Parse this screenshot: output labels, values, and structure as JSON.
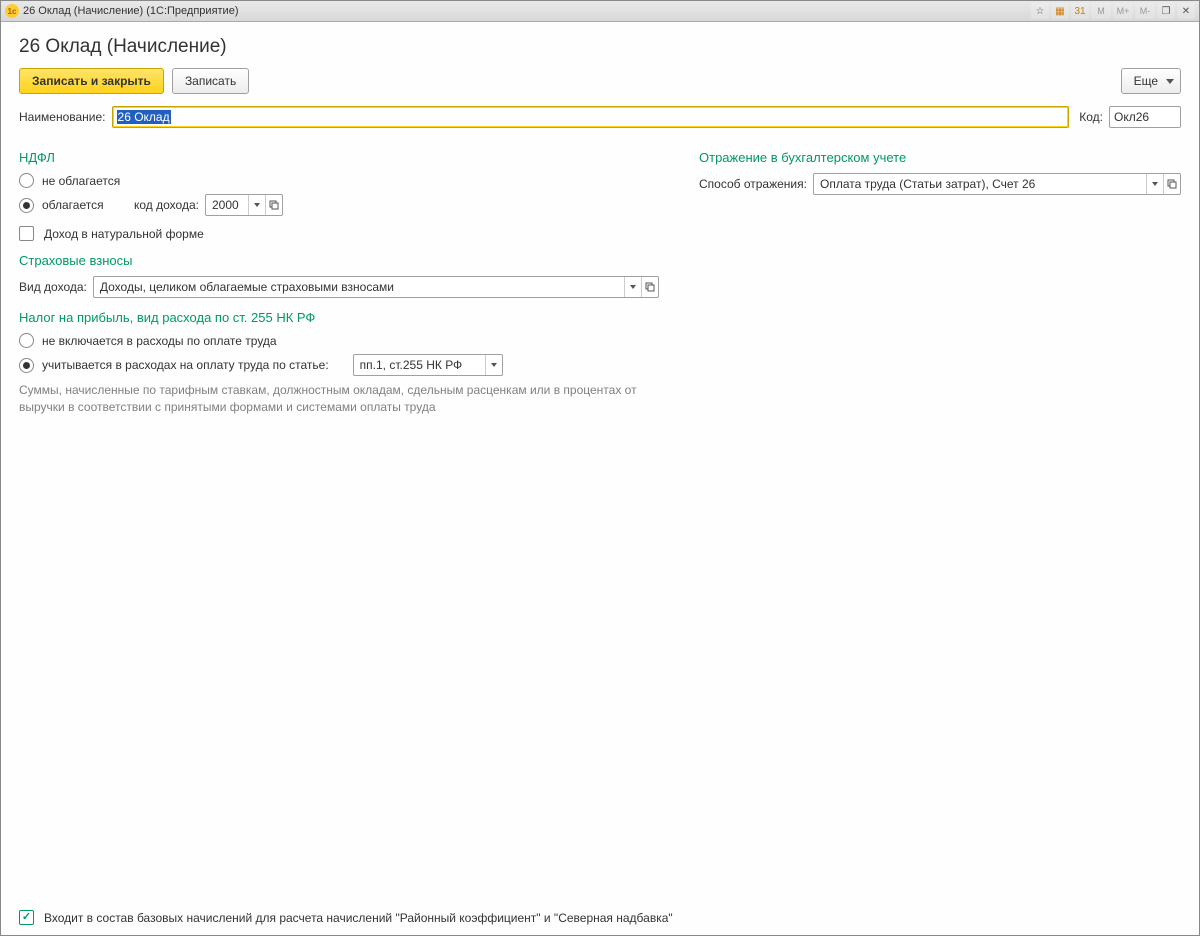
{
  "window": {
    "title": "26 Оклад (Начисление)  (1С:Предприятие)"
  },
  "page": {
    "title": "26 Оклад (Начисление)"
  },
  "toolbar": {
    "save_close": "Записать и закрыть",
    "save": "Записать",
    "more": "Еще"
  },
  "fields": {
    "name_label": "Наименование:",
    "name_value": "26 Оклад",
    "code_label": "Код:",
    "code_value": "Окл26"
  },
  "ndfl": {
    "title": "НДФЛ",
    "not_taxed": "не облагается",
    "taxed": "облагается",
    "taxed_selected": true,
    "income_code_label": "код дохода:",
    "income_code_value": "2000",
    "natural_income": "Доход в натуральной форме",
    "natural_income_checked": false
  },
  "insurance": {
    "title": "Страховые взносы",
    "income_type_label": "Вид дохода:",
    "income_type_value": "Доходы, целиком облагаемые страховыми взносами"
  },
  "profit_tax": {
    "title": "Налог на прибыль, вид расхода по ст. 255 НК РФ",
    "not_included": "не включается в расходы по оплате труда",
    "included": "учитывается в расходах на оплату труда по статье:",
    "included_selected": true,
    "article_value": "пп.1, ст.255 НК РФ",
    "hint": "Суммы, начисленные по тарифным ставкам, должностным окладам, сдельным расценкам или в процентах от выручки в соответствии с принятыми формами и системами оплаты труда"
  },
  "accounting": {
    "title": "Отражение в бухгалтерском учете",
    "method_label": "Способ отражения:",
    "method_value": "Оплата труда (Статьи затрат), Счет 26"
  },
  "footer": {
    "base_coeff_checked": true,
    "base_coeff_label": "Входит в состав базовых начислений для расчета начислений \"Районный коэффициент\" и \"Северная надбавка\""
  },
  "titlebar_buttons": {
    "m": "M",
    "mplus": "M+",
    "mminus": "M-"
  }
}
